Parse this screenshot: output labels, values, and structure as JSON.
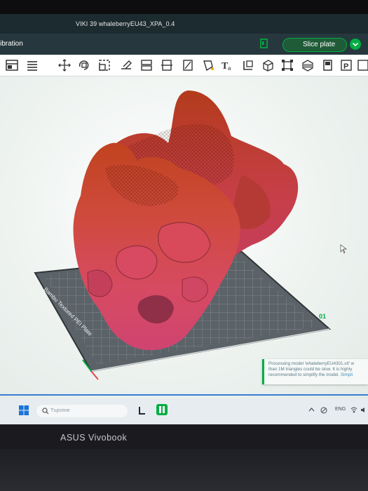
{
  "window": {
    "title": "VIKI 39 whaleberryEU43_XPA_0.4"
  },
  "appbar": {
    "menu_label": "ibration",
    "slice_label": "Slice plate"
  },
  "toolbar": {
    "icons": [
      "layout-icon",
      "list-icon",
      "move-icon",
      "rotate-icon",
      "scale-icon",
      "lay-on-face-icon",
      "split-icon",
      "cut-icon",
      "support-paint-icon",
      "seam-paint-icon",
      "color-paint-icon",
      "text-icon",
      "measure-icon",
      "boolean-icon",
      "assembly-icon",
      "fill-icon",
      "plate-icon",
      "p-icon",
      "export-icon"
    ]
  },
  "viewport": {
    "plate_label": "Bambu Textured PEI Plate",
    "plate_number": "01",
    "model": "whaleberryEU43 shoes"
  },
  "notification": {
    "text_line1": "Processing model 'whaleberryEU4301.stl' w",
    "text_line2": "than 1M triangles could be slow. It is highly",
    "text_line3": "recommended to simplify the model.",
    "link": "Simpli"
  },
  "taskbar": {
    "search_placeholder": "Търсене",
    "lang": "ENG"
  },
  "laptop": {
    "brand": "ASUS Vivobook"
  },
  "colors": {
    "accent": "#00ae42",
    "titlebar": "#1c2b30",
    "appbar": "#26383d",
    "model_top": "#c84b2e",
    "model_bottom": "#d94a6f"
  }
}
